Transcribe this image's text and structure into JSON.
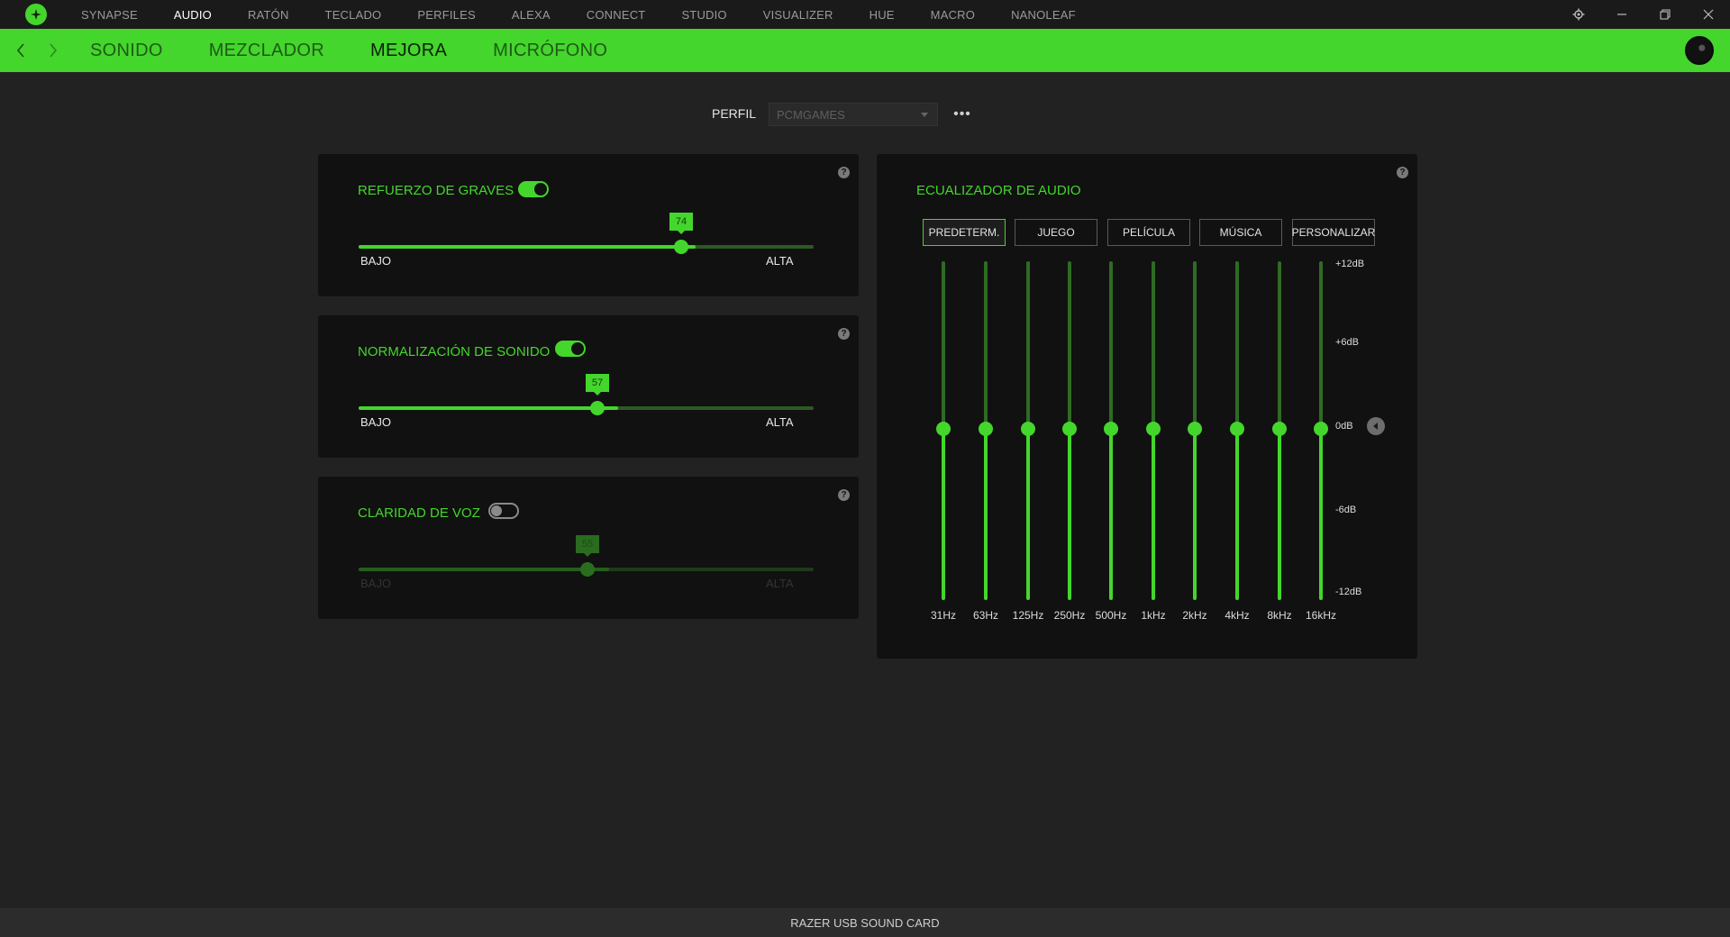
{
  "topnav": {
    "items": [
      "SYNAPSE",
      "AUDIO",
      "RATÓN",
      "TECLADO",
      "PERFILES",
      "ALEXA",
      "CONNECT",
      "STUDIO",
      "VISUALIZER",
      "HUE",
      "MACRO",
      "NANOLEAF"
    ],
    "active": "AUDIO"
  },
  "subnav": {
    "tabs": [
      "SONIDO",
      "MEZCLADOR",
      "MEJORA",
      "MICRÓFONO"
    ],
    "active": "MEJORA"
  },
  "profile": {
    "label": "PERFIL",
    "value": "PCMGAMES",
    "more": "•••"
  },
  "panels": {
    "bass": {
      "title": "REFUERZO DE GRAVES",
      "enabled": true,
      "value": 74,
      "low": "BAJO",
      "high": "ALTA"
    },
    "normalization": {
      "title": "NORMALIZACIÓN DE SONIDO",
      "enabled": true,
      "value": 57,
      "low": "BAJO",
      "high": "ALTA"
    },
    "voice": {
      "title": "CLARIDAD DE VOZ",
      "enabled": false,
      "value": 55,
      "low": "BAJO",
      "high": "ALTA"
    }
  },
  "help": "?",
  "equalizer": {
    "title": "ECUALIZADOR DE AUDIO",
    "presets": [
      "PREDETERM.",
      "JUEGO",
      "PELÍCULA",
      "MÚSICA",
      "PERSONALIZAR"
    ],
    "active_preset": "PREDETERM.",
    "bands": [
      "31Hz",
      "63Hz",
      "125Hz",
      "250Hz",
      "500Hz",
      "1kHz",
      "2kHz",
      "4kHz",
      "8kHz",
      "16kHz"
    ],
    "band_values_db": [
      0,
      0,
      0,
      0,
      0,
      0,
      0,
      0,
      0,
      0
    ],
    "db_labels": [
      "+12dB",
      "+6dB",
      "0dB",
      "-6dB",
      "-12dB"
    ]
  },
  "footer": {
    "device": "RAZER USB SOUND CARD"
  },
  "colors": {
    "accent": "#44d62c",
    "background": "#222222",
    "panel": "#111111"
  }
}
